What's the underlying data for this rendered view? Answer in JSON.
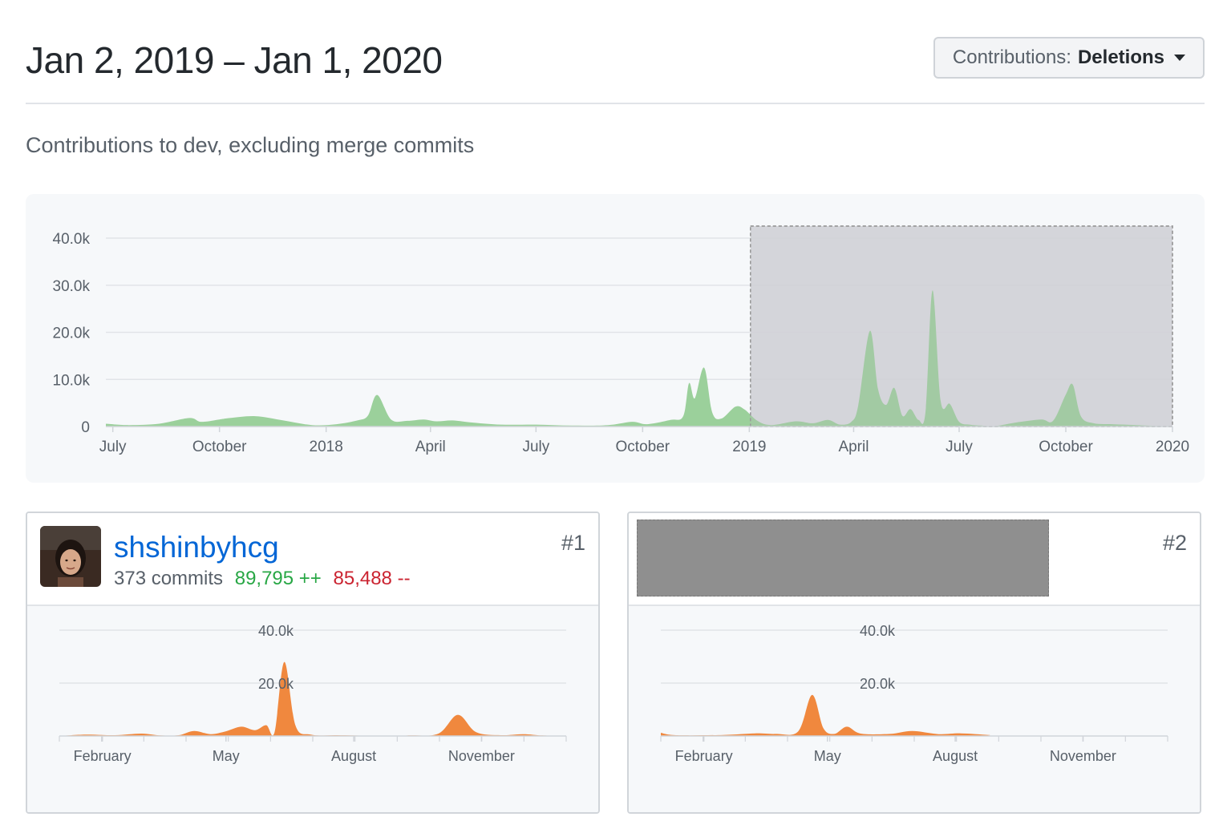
{
  "header": {
    "range_title": "Jan 2, 2019 – Jan 1, 2020",
    "contrib_prefix": "Contributions:",
    "contrib_value": "Deletions"
  },
  "subtitle": "Contributions to dev, excluding merge commits",
  "colors": {
    "main_area": "#9bd09b",
    "selection": "#d9dbe0",
    "user_area": "#f0883e",
    "link": "#0366d6",
    "additions": "#28a745",
    "deletions": "#cb2431"
  },
  "chart_data": [
    {
      "type": "area",
      "ylim": [
        0,
        40000
      ],
      "yticks": [
        0,
        10000,
        20000,
        30000,
        40000
      ],
      "ytick_labels": [
        "0",
        "10.0k",
        "20.0k",
        "30.0k",
        "40.0k"
      ],
      "xlim": [
        "2017-06-25",
        "2020-01-01"
      ],
      "xticks": [
        "2017-07-01",
        "2017-10-01",
        "2018-01-01",
        "2018-04-01",
        "2018-07-01",
        "2018-10-01",
        "2019-01-01",
        "2019-04-01",
        "2019-07-01",
        "2019-10-01",
        "2020-01-01"
      ],
      "xtick_labels": [
        "July",
        "October",
        "2018",
        "April",
        "July",
        "October",
        "2019",
        "April",
        "July",
        "October",
        "2020"
      ],
      "selection": [
        "2019-01-02",
        "2020-01-01"
      ],
      "grid": true,
      "x": [
        "2017-06-25",
        "2017-07-15",
        "2017-08-10",
        "2017-09-05",
        "2017-09-15",
        "2017-10-01",
        "2017-10-10",
        "2017-11-01",
        "2017-11-25",
        "2017-12-20",
        "2018-01-10",
        "2018-01-28",
        "2018-02-06",
        "2018-02-14",
        "2018-02-26",
        "2018-03-12",
        "2018-03-26",
        "2018-04-06",
        "2018-04-20",
        "2018-05-05",
        "2018-06-01",
        "2018-07-01",
        "2018-08-01",
        "2018-09-01",
        "2018-09-22",
        "2018-10-05",
        "2018-10-25",
        "2018-11-05",
        "2018-11-10",
        "2018-11-15",
        "2018-11-23",
        "2018-11-30",
        "2018-12-08",
        "2018-12-20",
        "2018-12-28",
        "2019-01-08",
        "2019-01-20",
        "2019-02-10",
        "2019-02-25",
        "2019-03-10",
        "2019-03-20",
        "2019-03-30",
        "2019-04-05",
        "2019-04-15",
        "2019-04-22",
        "2019-04-29",
        "2019-05-06",
        "2019-05-13",
        "2019-05-20",
        "2019-05-27",
        "2019-06-02",
        "2019-06-08",
        "2019-06-15",
        "2019-06-23",
        "2019-07-01",
        "2019-07-10",
        "2019-07-20",
        "2019-08-01",
        "2019-08-20",
        "2019-09-10",
        "2019-09-20",
        "2019-10-01",
        "2019-10-07",
        "2019-10-14",
        "2019-10-25",
        "2019-11-10",
        "2019-12-01",
        "2019-12-20",
        "2020-01-01"
      ],
      "series": [
        {
          "values": [
            600,
            300,
            600,
            1800,
            1000,
            1500,
            1800,
            2200,
            1300,
            300,
            500,
            1300,
            2300,
            6700,
            1500,
            1200,
            1500,
            1100,
            1300,
            900,
            400,
            400,
            200,
            300,
            1000,
            500,
            1400,
            2200,
            9200,
            6000,
            12500,
            3000,
            1700,
            4200,
            3600,
            1200,
            300,
            1100,
            700,
            1400,
            400,
            1000,
            4500,
            20300,
            8000,
            4600,
            8200,
            2300,
            3700,
            1400,
            3200,
            28900,
            5500,
            4800,
            1000,
            400,
            200,
            100,
            900,
            1500,
            1200,
            6800,
            8900,
            2200,
            700,
            500,
            300,
            100,
            0
          ]
        }
      ]
    },
    {
      "type": "area",
      "ylim": [
        0,
        40000
      ],
      "yticks": [
        20000,
        40000
      ],
      "ytick_labels": [
        "20.0k",
        "40.0k"
      ],
      "xlim": [
        "2019-01-01",
        "2020-01-01"
      ],
      "xticks": [
        "2019-02-01",
        "2019-05-01",
        "2019-08-01",
        "2019-11-01"
      ],
      "xtick_labels": [
        "February",
        "May",
        "August",
        "November"
      ],
      "grid": true,
      "x": [
        "2019-01-01",
        "2019-01-20",
        "2019-02-10",
        "2019-03-01",
        "2019-03-15",
        "2019-03-28",
        "2019-04-08",
        "2019-04-20",
        "2019-05-01",
        "2019-05-12",
        "2019-05-22",
        "2019-05-30",
        "2019-06-05",
        "2019-06-12",
        "2019-06-20",
        "2019-07-01",
        "2019-07-20",
        "2019-08-15",
        "2019-09-10",
        "2019-10-01",
        "2019-10-15",
        "2019-10-28",
        "2019-11-15",
        "2019-12-01",
        "2019-12-15",
        "2020-01-01"
      ],
      "series": [
        {
          "values": [
            0,
            500,
            300,
            900,
            200,
            300,
            1900,
            700,
            1800,
            3500,
            2200,
            4100,
            1500,
            28000,
            4000,
            500,
            300,
            100,
            200,
            900,
            8000,
            1500,
            300,
            700,
            200,
            0
          ]
        }
      ]
    },
    {
      "type": "area",
      "ylim": [
        0,
        40000
      ],
      "yticks": [
        20000,
        40000
      ],
      "ytick_labels": [
        "20.0k",
        "40.0k"
      ],
      "xlim": [
        "2019-01-01",
        "2020-01-01"
      ],
      "xticks": [
        "2019-02-01",
        "2019-05-01",
        "2019-08-01",
        "2019-11-01"
      ],
      "xtick_labels": [
        "February",
        "May",
        "August",
        "November"
      ],
      "grid": true,
      "x": [
        "2019-01-01",
        "2019-01-12",
        "2019-02-15",
        "2019-03-10",
        "2019-03-25",
        "2019-04-10",
        "2019-04-20",
        "2019-04-28",
        "2019-05-06",
        "2019-05-15",
        "2019-05-25",
        "2019-06-15",
        "2019-07-01",
        "2019-07-20",
        "2019-08-05",
        "2019-08-25",
        "2019-09-05",
        "2020-01-01"
      ],
      "series": [
        {
          "values": [
            1200,
            300,
            400,
            1000,
            800,
            1800,
            15500,
            3000,
            800,
            3500,
            900,
            800,
            1900,
            700,
            1000,
            400,
            0,
            0
          ]
        }
      ]
    }
  ],
  "contributors": [
    {
      "username": "shshinbyhcg",
      "commits": "373 commits",
      "additions": "89,795 ++",
      "deletions": "85,488 --",
      "rank": "#1"
    },
    {
      "rank": "#2"
    }
  ]
}
